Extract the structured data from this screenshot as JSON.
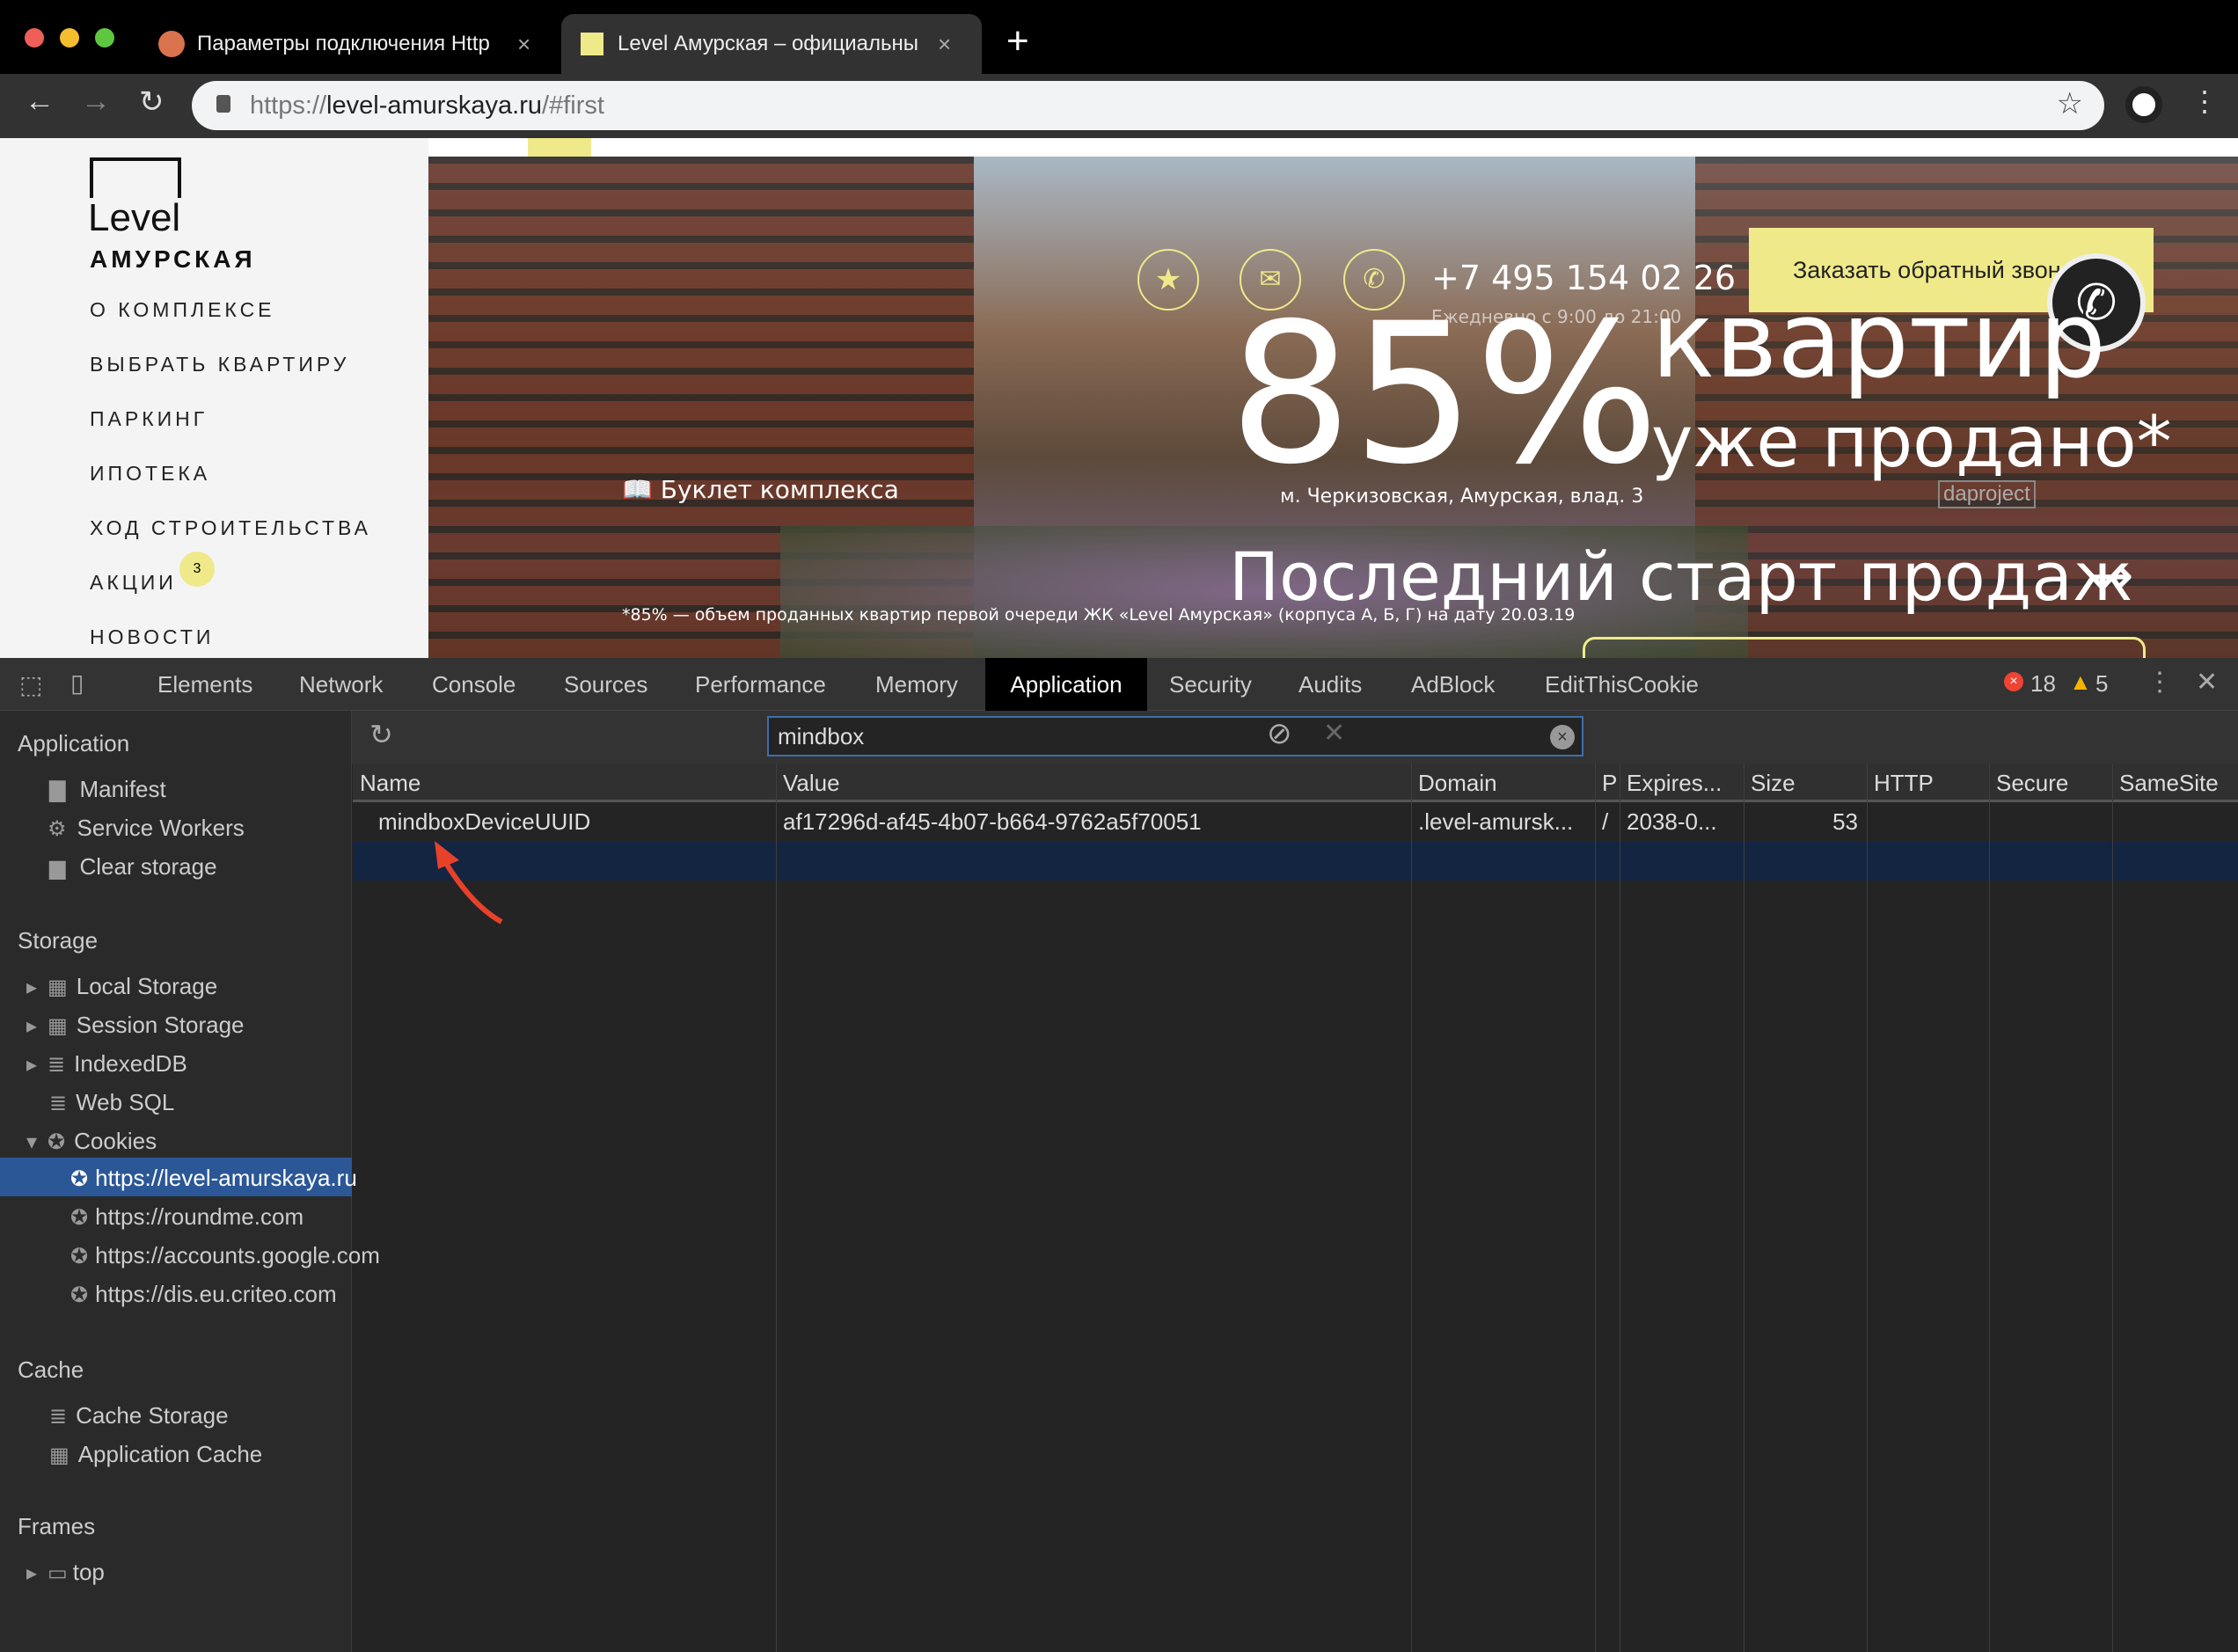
{
  "browser": {
    "tabs": [
      {
        "title": "Параметры подключения Http",
        "active": false
      },
      {
        "title": "Level Амурская – официальны",
        "active": true
      }
    ],
    "url_prefix": "https://",
    "url_host": "level-amurskaya.ru",
    "url_path": "/#first",
    "new_tab": "+",
    "close": "×"
  },
  "site": {
    "logo_word": "Level",
    "logo_sub": "АМУРСКАЯ",
    "nav": [
      "О КОМПЛЕКСЕ",
      "ВЫБРАТЬ КВАРТИРУ",
      "ПАРКИНГ",
      "ИПОТЕКА",
      "ХОД СТРОИТЕЛЬСТВА",
      "АКЦИИ",
      "НОВОСТИ"
    ],
    "promo_badge": "3",
    "phone": "+7 495 154 02 26",
    "hours": "Ежедневно с 9:00 до 21:00",
    "callback": "Заказать обратный звонок",
    "big_percent": "85%",
    "headline1": "квартир",
    "headline2": "уже продано*",
    "address": "м. Черкизовская, Амурская, влад. 3",
    "booklet": "Буклет комплекса",
    "footnote": "*85% — объем проданных квартир первой очереди ЖК «Level Амурская» (корпуса А, Б, Г) на дату 20.03.19",
    "last_start": "Последний старт продаж",
    "arrow": "→",
    "watermark": "daproject",
    "accent": "#f0eb8f"
  },
  "devtools": {
    "tabs": [
      "Elements",
      "Network",
      "Console",
      "Sources",
      "Performance",
      "Memory",
      "Application",
      "Security",
      "Audits",
      "AdBlock",
      "EditThisCookie"
    ],
    "active_tab": "Application",
    "errors": "18",
    "warnings": "5",
    "sidebar": {
      "application_header": "Application",
      "application_items": [
        "Manifest",
        "Service Workers",
        "Clear storage"
      ],
      "storage_header": "Storage",
      "storage_items": [
        "Local Storage",
        "Session Storage",
        "IndexedDB",
        "Web SQL",
        "Cookies"
      ],
      "cookie_origins": [
        "https://level-amurskaya.ru",
        "https://roundme.com",
        "https://accounts.google.com",
        "https://dis.eu.criteo.com"
      ],
      "cache_header": "Cache",
      "cache_items": [
        "Cache Storage",
        "Application Cache"
      ],
      "frames_header": "Frames",
      "frames_items": [
        "top"
      ]
    },
    "filter": {
      "value": "mindbox"
    },
    "table": {
      "columns": [
        "Name",
        "Value",
        "Domain",
        "P",
        "Expires...",
        "Size",
        "HTTP",
        "Secure",
        "SameSite"
      ],
      "rows": [
        [
          "mindboxDeviceUUID",
          "af17296d-af45-4b07-b664-9762a5f70051",
          ".level-amursk...",
          "/",
          "2038-0...",
          "53",
          "",
          "",
          ""
        ]
      ]
    }
  },
  "annotation": {
    "arrow_color": "#e8412a"
  }
}
